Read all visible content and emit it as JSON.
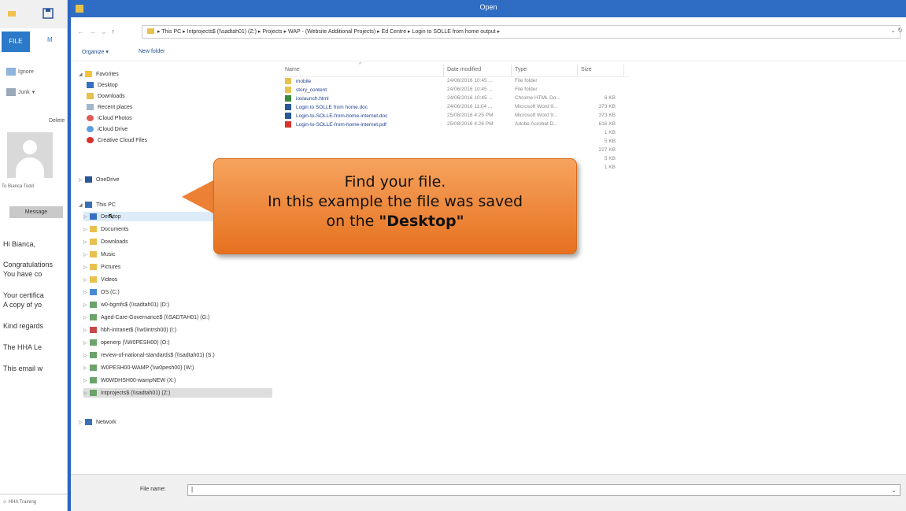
{
  "outlook": {
    "file_tab": "FILE",
    "tab2": "M",
    "ignore": "Ignore",
    "junk": "Junk",
    "delete": "Delete",
    "sender": "Bianca Todd",
    "message_tab": "Message",
    "body": [
      "Hi Bianca,",
      "Congratulations",
      "You have co",
      "Your certifica",
      "A copy of yo",
      "Kind regards",
      "The HHA Le",
      "This email w"
    ],
    "footer": "HHA Training"
  },
  "dialog": {
    "title": "Open",
    "address": {
      "path": "▸ This PC ▸ Intprojects$ (\\\\sadtah01) (Z:) ▸ Projects ▸ WAP - (Website Additional Projects) ▸ Ed Centre ▸ Login to SOLLE from home output ▸",
      "right": "⌄ ↻"
    },
    "toolbar": {
      "organize": "Organize ▾",
      "new_folder": "New folder"
    },
    "nav": {
      "favorites": "Favorites",
      "fav_items": [
        "Desktop",
        "Downloads",
        "Recent places",
        "iCloud Photos",
        "iCloud Drive",
        "Creative Cloud Files"
      ],
      "onedrive": "OneDrive",
      "this_pc": "This PC",
      "pc_items": [
        "Desktop",
        "Documents",
        "Downloads",
        "Music",
        "Pictures",
        "Videos",
        "OS (C:)",
        "w0-bgmfs$ (\\\\sadtah01) (D:)",
        "Aged-Care-Governance$ (\\\\SADTAH01) (G:)",
        "hbh-intranet$ (\\\\w0intrsh00) (I:)",
        "openerp (\\\\W0PESH00) (O:)",
        "review-of-national-standards$ (\\\\sadtah01) (S:)",
        "W0PESH00-WAMP (\\\\w0pesh00) (W:)",
        "W0WDHSH00-wampNEW (X:)",
        "Intprojects$ (\\\\sadtah01) (Z:)"
      ],
      "network": "Network"
    },
    "columns": {
      "name": "Name",
      "date": "Date modified",
      "type": "Type",
      "size": "Size"
    },
    "files": [
      {
        "name": "mobile",
        "date": "24/06/2016 10:45 ...",
        "type": "File folder",
        "size": ""
      },
      {
        "name": "story_content",
        "date": "24/06/2016 10:45 ...",
        "type": "File folder",
        "size": ""
      },
      {
        "name": "ioslaunch.html",
        "date": "24/06/2016 10:45 ...",
        "type": "Chrome HTML Do...",
        "size": "6 KB"
      },
      {
        "name": "Login to SOLLE from home.doc",
        "date": "24/06/2016 11:04 ...",
        "type": "Microsoft Word 9...",
        "size": "373 KB"
      },
      {
        "name": "Login-to-SOLLE-from-home-internet.doc",
        "date": "25/08/2016 4:25 PM",
        "type": "Microsoft Word 9...",
        "size": "373 KB"
      },
      {
        "name": "Login-to-SOLLE-from-home-internet.pdf",
        "date": "25/08/2016 4:26 PM",
        "type": "Adobe Acrobat D...",
        "size": "616 KB"
      },
      {
        "name": "",
        "date": "",
        "type": "",
        "size": "1 KB"
      },
      {
        "name": "",
        "date": "",
        "type": "",
        "size": "5 KB"
      },
      {
        "name": "",
        "date": "",
        "type": "",
        "size": "227 KB"
      },
      {
        "name": "",
        "date": "",
        "type": "",
        "size": "5 KB"
      },
      {
        "name": "",
        "date": "",
        "type": "",
        "size": "1 KB"
      }
    ],
    "filename_label": "File name:",
    "filename_value": ""
  },
  "callout": {
    "line1": "Find your file.",
    "line2": "In this example the file was saved",
    "line3_prefix": "on the ",
    "line3_bold": "\"Desktop\""
  },
  "colors": {
    "titlebar": "#2f6dc4",
    "callout": "#ec8034",
    "folder": "#e8c04e"
  }
}
